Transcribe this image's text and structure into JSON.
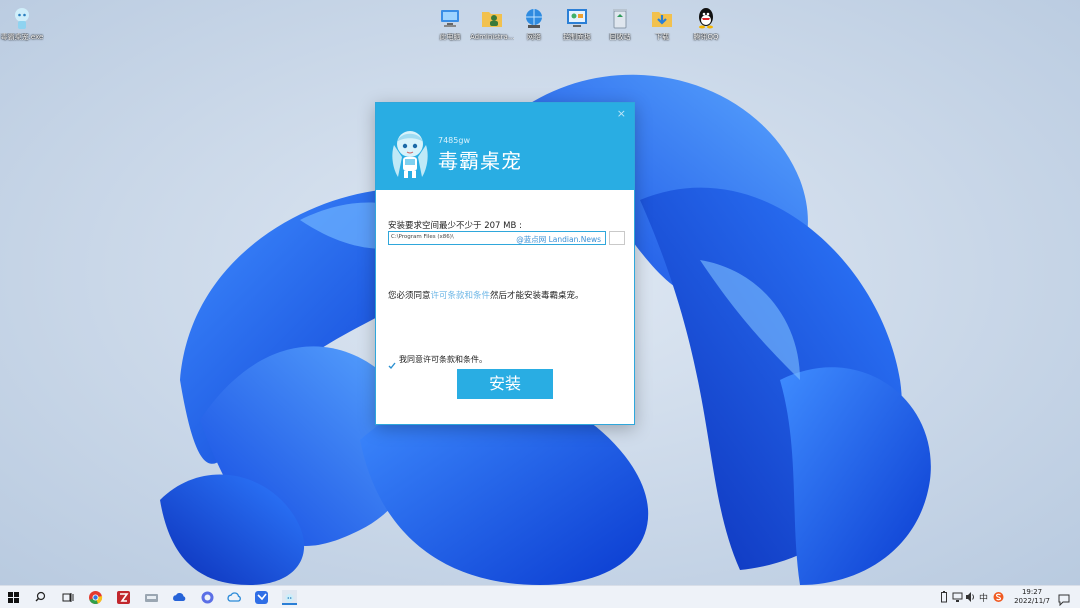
{
  "desktop": {
    "icons": [
      {
        "label": "毒霸桌宠.exe",
        "icon": "mascot-icon"
      },
      {
        "label": "此电脑",
        "icon": "computer-icon"
      },
      {
        "label": "Administra...",
        "icon": "user-folder-icon"
      },
      {
        "label": "网络",
        "icon": "network-icon"
      },
      {
        "label": "控制面板",
        "icon": "control-panel-icon"
      },
      {
        "label": "回收站",
        "icon": "recycle-bin-icon"
      },
      {
        "label": "下载",
        "icon": "download-folder-icon"
      },
      {
        "label": "腾讯QQ",
        "icon": "qq-icon"
      }
    ]
  },
  "dialog": {
    "version": "7485gw",
    "title": "毒霸桌宠",
    "close": "×",
    "space_label": "安装要求空间最少不少于 207 MB :",
    "install_path": "C:\\Program Files (x86)\\",
    "watermark": "@蓝点网 Landian.News",
    "terms_prefix": "您必须同意",
    "terms_link": "许可条款和条件",
    "terms_suffix": "然后才能安装毒霸桌宠。",
    "agree_label": "我同意许可条款和条件。",
    "agree_checked": true,
    "install_button": "安装"
  },
  "taskbar": {
    "apps": [
      "windows-start-icon",
      "search-icon",
      "task-view-icon",
      "chrome-icon",
      "filezilla-icon",
      "scanner-icon",
      "onedrive-icon",
      "browser-circle-icon",
      "cloud-drive-icon",
      "feishu-icon",
      "installer-taskbar-icon"
    ],
    "tray_ime": "中",
    "time": "19:27",
    "date": "2022/11/7"
  },
  "colors": {
    "accent": "#29ade3",
    "link": "#6cb6e6"
  }
}
